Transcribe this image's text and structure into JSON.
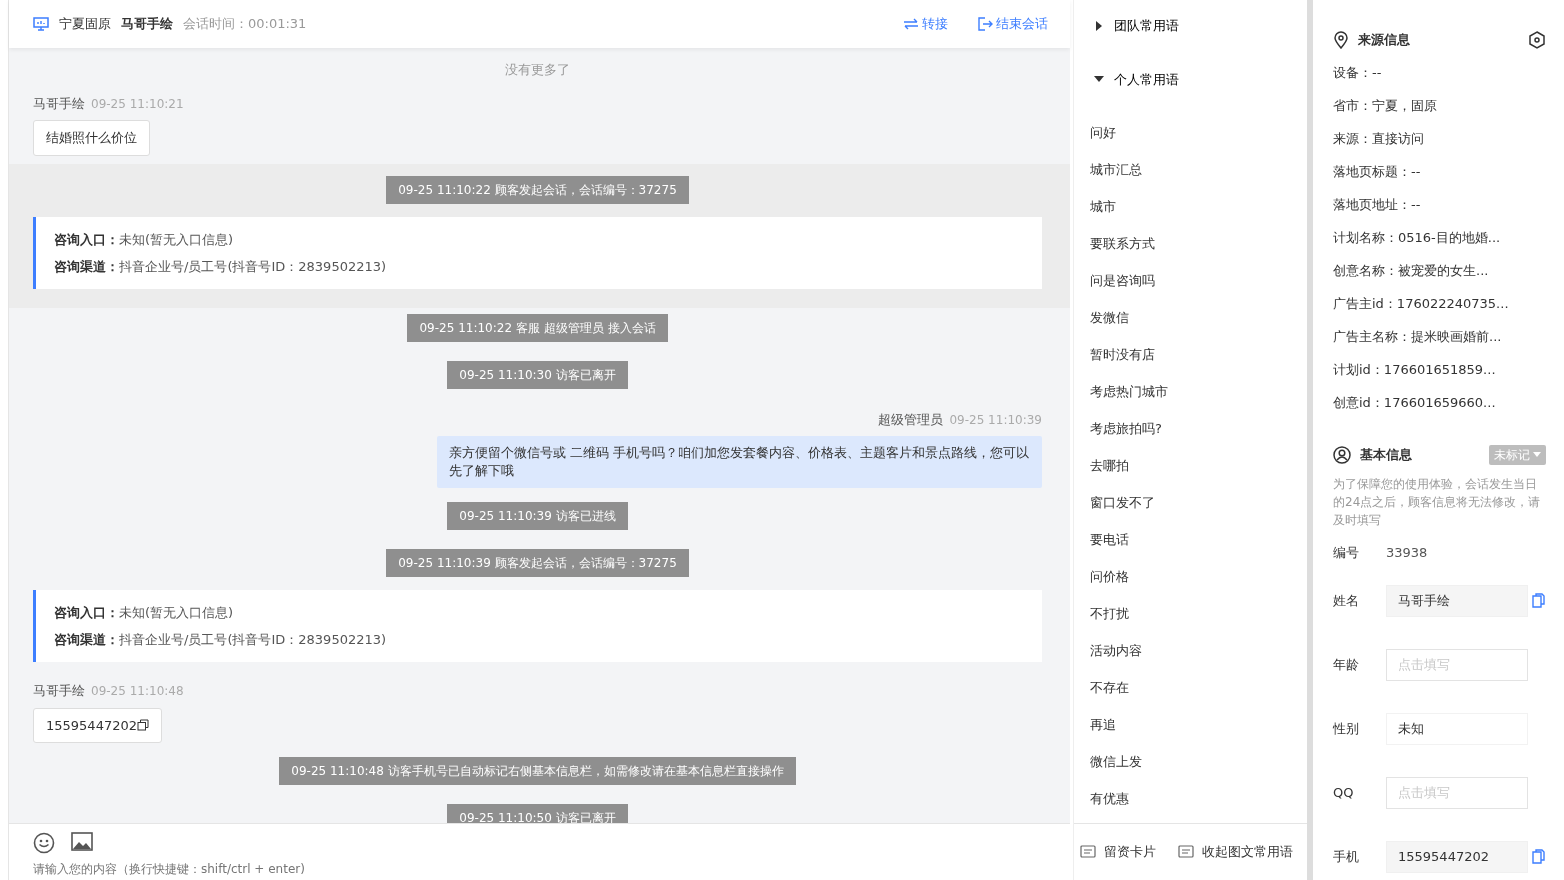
{
  "header": {
    "location": "宁夏固原",
    "visitor": "马哥手绘",
    "duration": "会话时间：00:01:31",
    "actions": [
      {
        "label": "转接",
        "kind": "transfer"
      },
      {
        "label": "结束会话",
        "kind": "end"
      }
    ]
  },
  "chat": {
    "top_note": "没有更多了",
    "messages": [
      {
        "kind": "visitor",
        "sender": "马哥手绘",
        "time": "09-25 11:10:21",
        "text": "结婚照什么价位",
        "copyable": false
      },
      {
        "kind": "group",
        "highlighted": true,
        "messages": [
          {
            "kind": "notice",
            "text": "09-25 11:10:22 顾客发起会话，会话编号：37275"
          },
          {
            "kind": "entry",
            "lines": [
              {
                "label": "咨询入口：",
                "value": "未知(暂无入口信息)"
              },
              {
                "label": "咨询渠道：",
                "value": "抖音企业号/员工号(抖音号ID：2839502213)"
              }
            ]
          }
        ]
      },
      {
        "kind": "notice",
        "text": "09-25 11:10:22 客服 超级管理员 接入会话"
      },
      {
        "kind": "notice",
        "text": "09-25 11:10:30 访客已离开"
      },
      {
        "kind": "agent",
        "sender": "超级管理员",
        "time": "09-25 11:10:39",
        "text": "亲方便留个微信号或 二维码 手机号吗？咱们加您发套餐内容、价格表、主题客片和景点路线，您可以先了解下哦"
      },
      {
        "kind": "notice",
        "text": "09-25 11:10:39 访客已进线"
      },
      {
        "kind": "notice",
        "text": "09-25 11:10:39 顾客发起会话，会话编号：37275"
      },
      {
        "kind": "entry",
        "lines": [
          {
            "label": "咨询入口：",
            "value": "未知(暂无入口信息)"
          },
          {
            "label": "咨询渠道：",
            "value": "抖音企业号/员工号(抖音号ID：2839502213)"
          }
        ]
      },
      {
        "kind": "visitor",
        "sender": "马哥手绘",
        "time": "09-25 11:10:48",
        "text": "15595447202",
        "copyable": true
      },
      {
        "kind": "notice",
        "text": "09-25 11:10:48 访客手机号已自动标记右侧基本信息栏，如需修改请在基本信息栏直接操作"
      },
      {
        "kind": "notice",
        "text": "09-25 11:10:50 访客已离开"
      }
    ],
    "input": {
      "placeholder": "请输入您的内容（换行快捷键：shift/ctrl + enter)"
    }
  },
  "phrases": {
    "groups": [
      {
        "title": "团队常用语",
        "expanded": false
      },
      {
        "title": "个人常用语",
        "expanded": true,
        "items": [
          "问好",
          "城市汇总",
          "城市",
          "要联系方式",
          "问是咨询吗",
          "发微信",
          "暂时没有店",
          "考虑热门城市",
          "考虑旅拍吗?",
          "去哪拍",
          "窗口发不了",
          "要电话",
          "问价格",
          "不打扰",
          "活动内容",
          "不存在",
          "再追",
          "微信上发",
          "有优惠"
        ]
      }
    ],
    "footer": [
      "留资卡片",
      "收起图文常用语"
    ]
  },
  "source_info": {
    "title": "来源信息",
    "rows": [
      "设备：--",
      "省市：宁夏，固原",
      "来源：直接访问",
      "落地页标题：--",
      "落地页地址：--",
      "计划名称：0516-目的地婚...",
      "创意名称：被宠爱的女生...",
      "广告主id：176022240735...",
      "广告主名称：提米映画婚前...",
      "计划id：176601651859...",
      "创意id：176601659660..."
    ]
  },
  "basic_info": {
    "title": "基本信息",
    "tag": "未标记",
    "notice": "为了保障您的使用体验，会话发生当日的24点之后，顾客信息将无法修改，请及时填写",
    "fields": [
      {
        "label": "编号",
        "kind": "text",
        "value": "33938"
      },
      {
        "label": "姓名",
        "kind": "copyable",
        "value": "马哥手绘"
      },
      {
        "label": "年龄",
        "kind": "input",
        "placeholder": "点击填写"
      },
      {
        "label": "性别",
        "kind": "select",
        "value": "未知"
      },
      {
        "label": "QQ",
        "kind": "input",
        "placeholder": "点击填写"
      },
      {
        "label": "手机",
        "kind": "copyable",
        "value": "15595447202"
      }
    ]
  }
}
